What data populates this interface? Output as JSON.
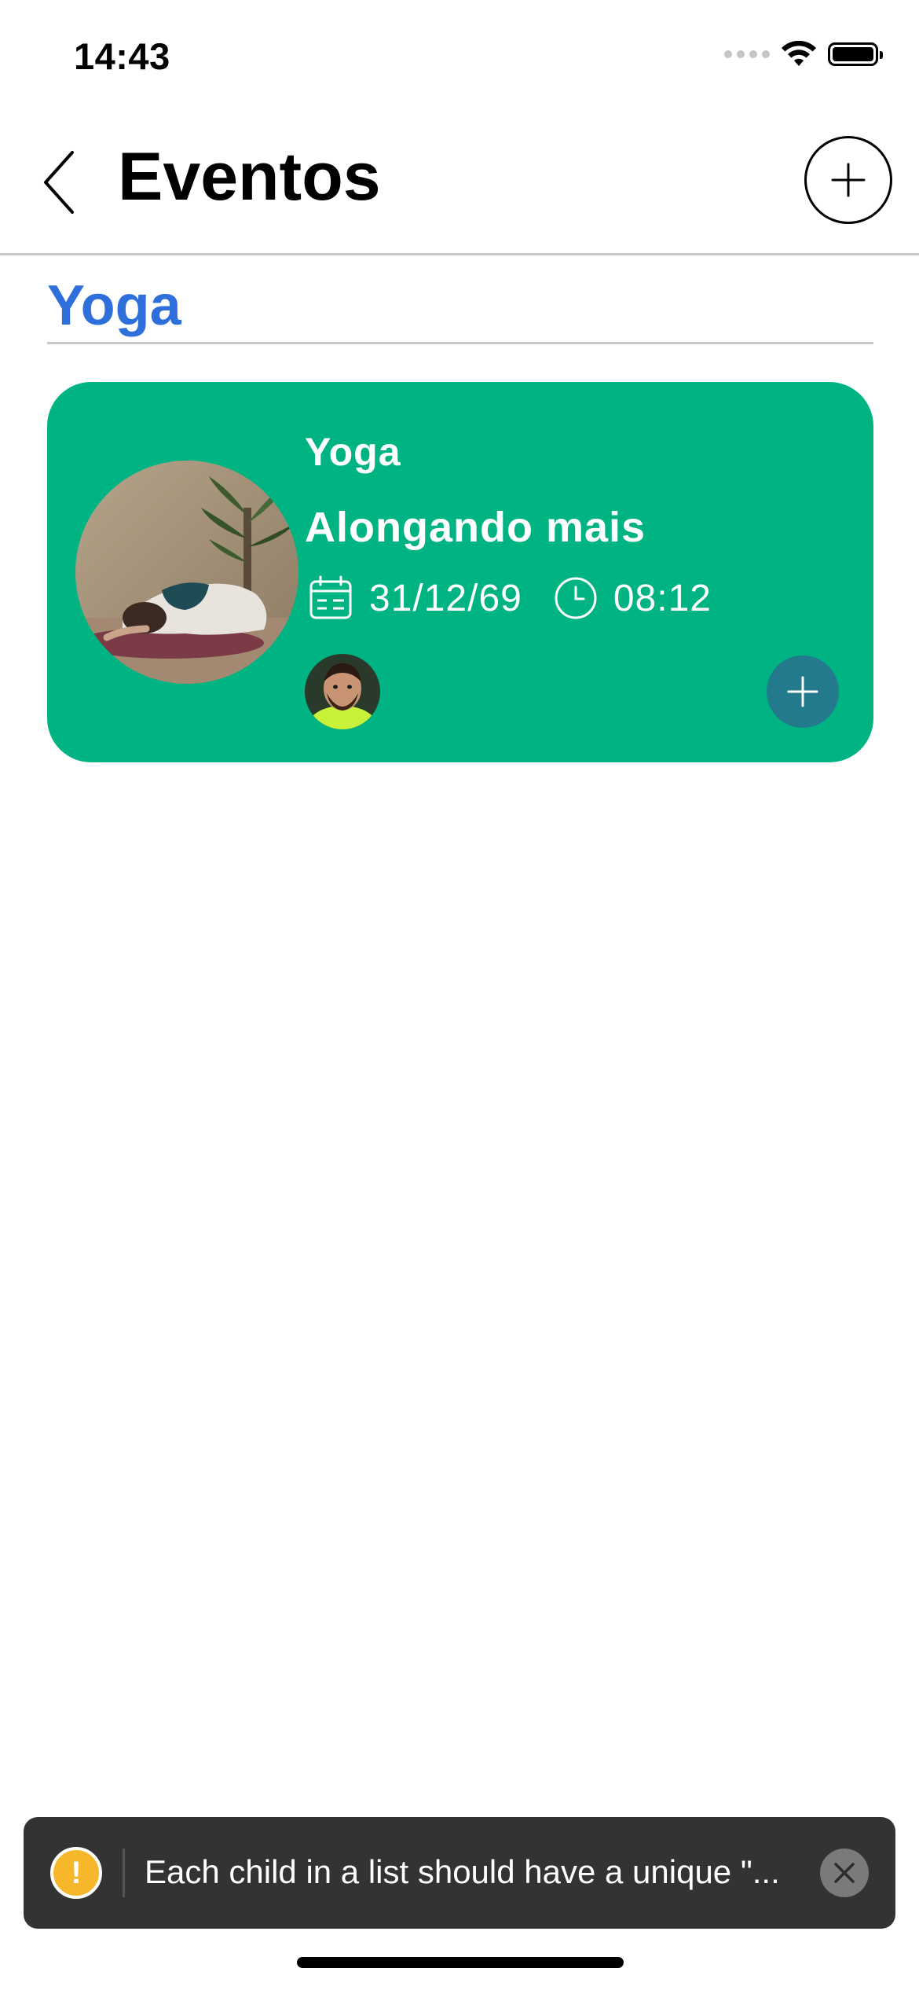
{
  "status_bar": {
    "time": "14:43"
  },
  "header": {
    "title": "Eventos",
    "back_icon": "chevron-left-icon",
    "add_icon": "plus-icon"
  },
  "section": {
    "title": "Yoga"
  },
  "event_card": {
    "name": "Yoga",
    "subtitle": "Alongando mais",
    "date": "31/12/69",
    "time": "08:12",
    "colors": {
      "card_background": "#00b383",
      "join_button": "#237a8c"
    }
  },
  "toast": {
    "message": "Each child in a list should have a unique \"...",
    "icon": "warning-icon",
    "close_icon": "close-icon"
  },
  "colors": {
    "section_title": "#2f6fdc",
    "toast_background": "#333333",
    "warning": "#f6b72b"
  }
}
